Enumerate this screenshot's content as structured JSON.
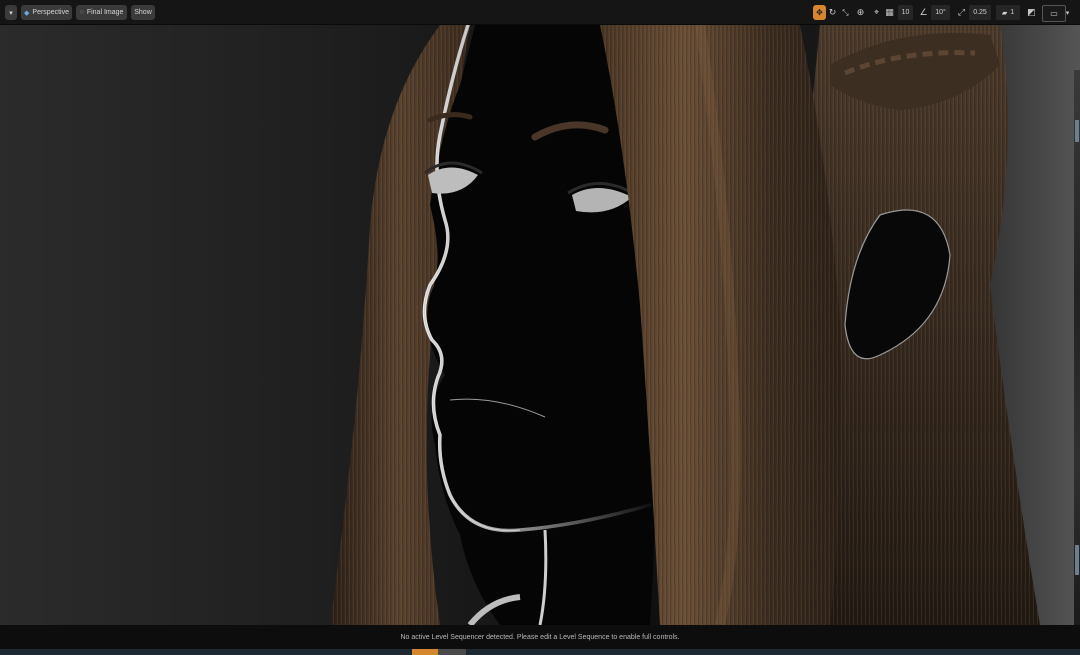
{
  "toolbar": {
    "viewport_menu_icon": "chevron-down-icon",
    "perspective_label": "Perspective",
    "final_image_label": "Final Image",
    "show_label": "Show",
    "grid_snap_value": "10",
    "rotation_snap_value": "10°",
    "scale_snap_value": "0.25",
    "camera_speed_value": "1",
    "accent_color": "#d6862c"
  },
  "status": {
    "message": "No active Level Sequencer detected. Please edit a Level Sequence to enable full controls."
  }
}
